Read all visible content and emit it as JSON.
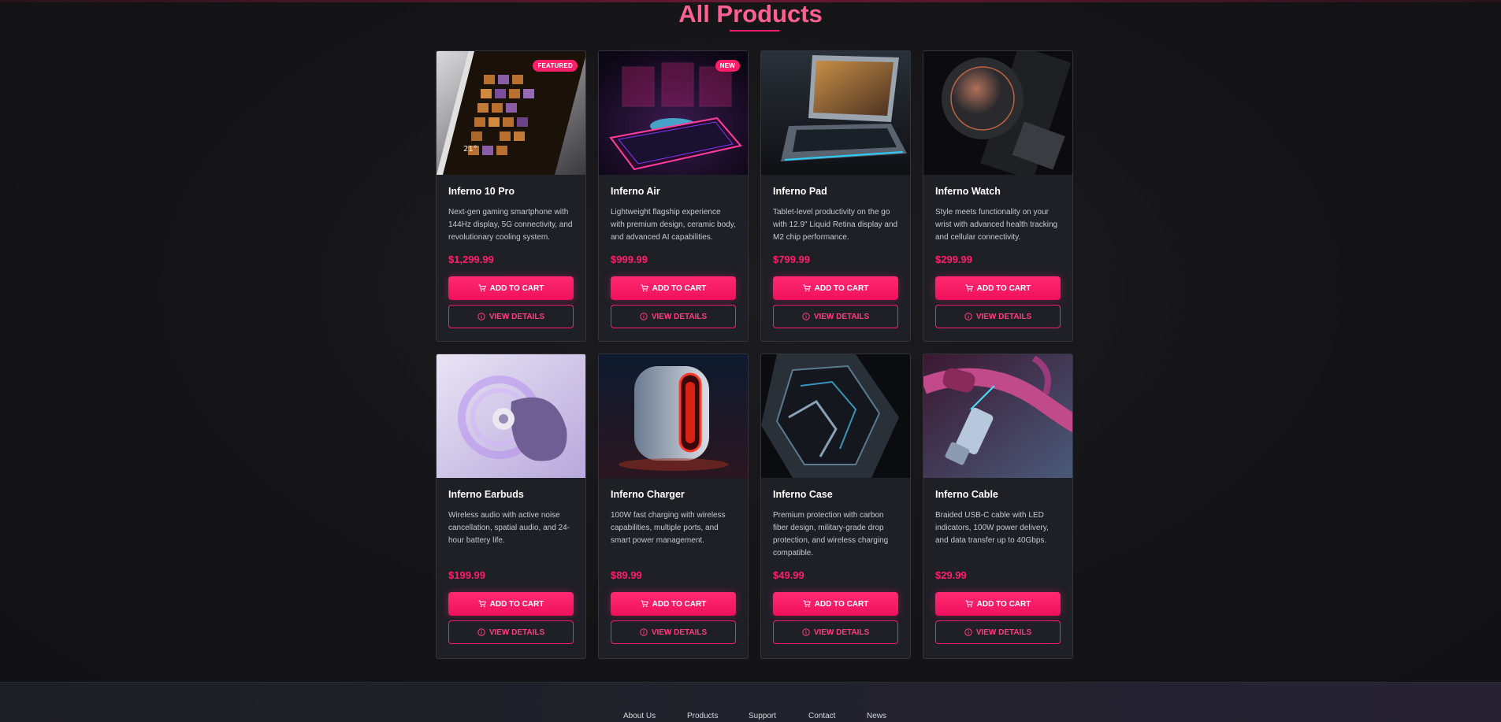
{
  "page": {
    "title": "All Products"
  },
  "colors": {
    "accent": "#ff1e6a",
    "background": "#141416",
    "card": "#1f1f26"
  },
  "products": [
    {
      "name": "Inferno 10 Pro",
      "description": "Next-gen gaming smartphone with 144Hz display, 5G connectivity, and revolutionary cooling system.",
      "price": "$1,299.99",
      "badge": "FEATURED",
      "image": "phone-tiles-image"
    },
    {
      "name": "Inferno Air",
      "description": "Lightweight flagship experience with premium design, ceramic body, and advanced AI capabilities.",
      "price": "$999.99",
      "badge": "NEW",
      "image": "hologram-phone-image"
    },
    {
      "name": "Inferno Pad",
      "description": "Tablet-level productivity on the go with 12.9\" Liquid Retina display and M2 chip performance.",
      "price": "$799.99",
      "badge": "",
      "image": "laptop-image"
    },
    {
      "name": "Inferno Watch",
      "description": "Style meets functionality on your wrist with advanced health tracking and cellular connectivity.",
      "price": "$299.99",
      "badge": "",
      "image": "watch-image"
    },
    {
      "name": "Inferno Earbuds",
      "description": "Wireless audio with active noise cancellation, spatial audio, and 24-hour battery life.",
      "price": "$199.99",
      "badge": "",
      "image": "earbud-image"
    },
    {
      "name": "Inferno Charger",
      "description": "100W fast charging with wireless capabilities, multiple ports, and smart power management.",
      "price": "$89.99",
      "badge": "",
      "image": "charger-image"
    },
    {
      "name": "Inferno Case",
      "description": "Premium protection with carbon fiber design, military-grade drop protection, and wireless charging compatible.",
      "price": "$49.99",
      "badge": "",
      "image": "case-image"
    },
    {
      "name": "Inferno Cable",
      "description": "Braided USB-C cable with LED indicators, 100W power delivery, and data transfer up to 40Gbps.",
      "price": "$29.99",
      "badge": "",
      "image": "cable-image"
    }
  ],
  "buttons": {
    "add_to_cart": "ADD TO CART",
    "view_details": "VIEW DETAILS"
  },
  "icons": {
    "cart": "cart-icon",
    "info": "info-icon"
  },
  "footer": {
    "links": [
      "About Us",
      "Products",
      "Support",
      "Contact",
      "News"
    ]
  }
}
